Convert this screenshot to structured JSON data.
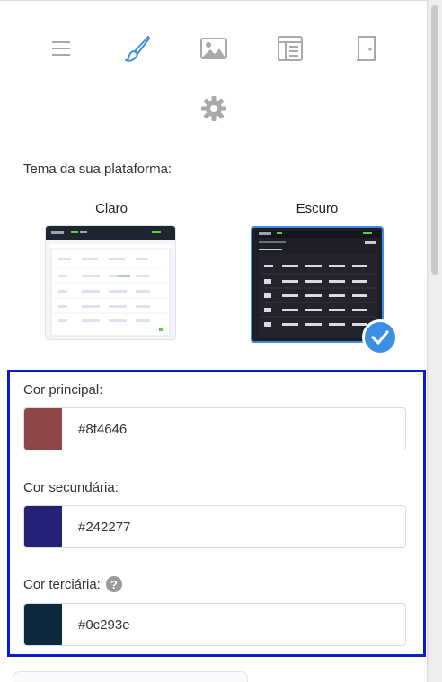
{
  "toolbar": {
    "icons": [
      {
        "name": "menu-icon",
        "active": false
      },
      {
        "name": "brush-icon",
        "active": true
      },
      {
        "name": "image-icon",
        "active": false
      },
      {
        "name": "layout-icon",
        "active": false
      },
      {
        "name": "door-icon",
        "active": false
      },
      {
        "name": "gear-icon",
        "active": false
      }
    ],
    "active_color": "#3a90e5",
    "inactive_color": "#a9a9a9"
  },
  "theme": {
    "title": "Tema da sua plataforma:",
    "options": [
      {
        "label": "Claro",
        "selected": false
      },
      {
        "label": "Escuro",
        "selected": true
      }
    ]
  },
  "colors": {
    "primary": {
      "label": "Cor principal:",
      "value": "#8f4646"
    },
    "secondary": {
      "label": "Cor secundária:",
      "value": "#242277"
    },
    "tertiary": {
      "label": "Cor terciária:",
      "value": "#0c293e",
      "help_icon": "?"
    }
  },
  "accents": {
    "selection_border": "#3a90e5",
    "highlight_box": "#0a1ecf"
  }
}
